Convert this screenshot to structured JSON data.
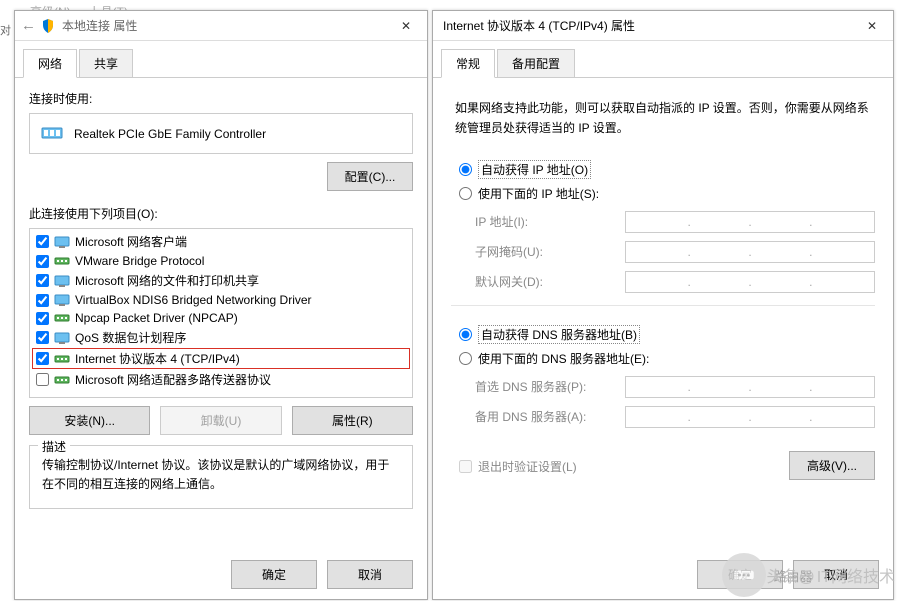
{
  "behind_menu": [
    "高级(N)",
    "上具(T)"
  ],
  "left_strip": "对",
  "left_window": {
    "title": "本地连接 属性",
    "tabs": [
      {
        "label": "网络",
        "active": true
      },
      {
        "label": "共享",
        "active": false
      }
    ],
    "connect_using_label": "连接时使用:",
    "adapter_name": "Realtek PCIe GbE Family Controller",
    "configure_btn": "配置(C)...",
    "items_label": "此连接使用下列项目(O):",
    "items": [
      {
        "checked": true,
        "label": "Microsoft 网络客户端",
        "icon": "client"
      },
      {
        "checked": true,
        "label": "VMware Bridge Protocol",
        "icon": "proto"
      },
      {
        "checked": true,
        "label": "Microsoft 网络的文件和打印机共享",
        "icon": "client"
      },
      {
        "checked": true,
        "label": "VirtualBox NDIS6 Bridged Networking Driver",
        "icon": "client"
      },
      {
        "checked": true,
        "label": "Npcap Packet Driver (NPCAP)",
        "icon": "proto"
      },
      {
        "checked": true,
        "label": "QoS 数据包计划程序",
        "icon": "client"
      },
      {
        "checked": true,
        "label": "Internet 协议版本 4 (TCP/IPv4)",
        "icon": "proto",
        "highlight": true
      },
      {
        "checked": false,
        "label": "Microsoft 网络适配器多路传送器协议",
        "icon": "proto"
      }
    ],
    "install_btn": "安装(N)...",
    "uninstall_btn": "卸载(U)",
    "properties_btn": "属性(R)",
    "desc_legend": "描述",
    "desc_text": "传输控制协议/Internet 协议。该协议是默认的广域网络协议，用于在不同的相互连接的网络上通信。",
    "ok_btn": "确定",
    "cancel_btn": "取消"
  },
  "right_window": {
    "title": "Internet 协议版本 4 (TCP/IPv4) 属性",
    "tabs": [
      {
        "label": "常规",
        "active": true
      },
      {
        "label": "备用配置",
        "active": false
      }
    ],
    "info_text": "如果网络支持此功能，则可以获取自动指派的 IP 设置。否则，你需要从网络系统管理员处获得适当的 IP 设置。",
    "ip_section": {
      "radio_auto": "自动获得 IP 地址(O)",
      "radio_manual": "使用下面的 IP 地址(S):",
      "selected": "auto",
      "fields": [
        {
          "label": "IP 地址(I):"
        },
        {
          "label": "子网掩码(U):"
        },
        {
          "label": "默认网关(D):"
        }
      ]
    },
    "dns_section": {
      "radio_auto": "自动获得 DNS 服务器地址(B)",
      "radio_manual": "使用下面的 DNS 服务器地址(E):",
      "selected": "auto",
      "fields": [
        {
          "label": "首选 DNS 服务器(P):"
        },
        {
          "label": "备用 DNS 服务器(A):"
        }
      ]
    },
    "validate_check": "退出时验证设置(L)",
    "advanced_btn": "高级(V)...",
    "ok_btn": "确定",
    "cancel_btn": "取消"
  },
  "watermark": {
    "prefix": "头条@",
    "text": "IT网络技术",
    "badge": "路由器"
  }
}
